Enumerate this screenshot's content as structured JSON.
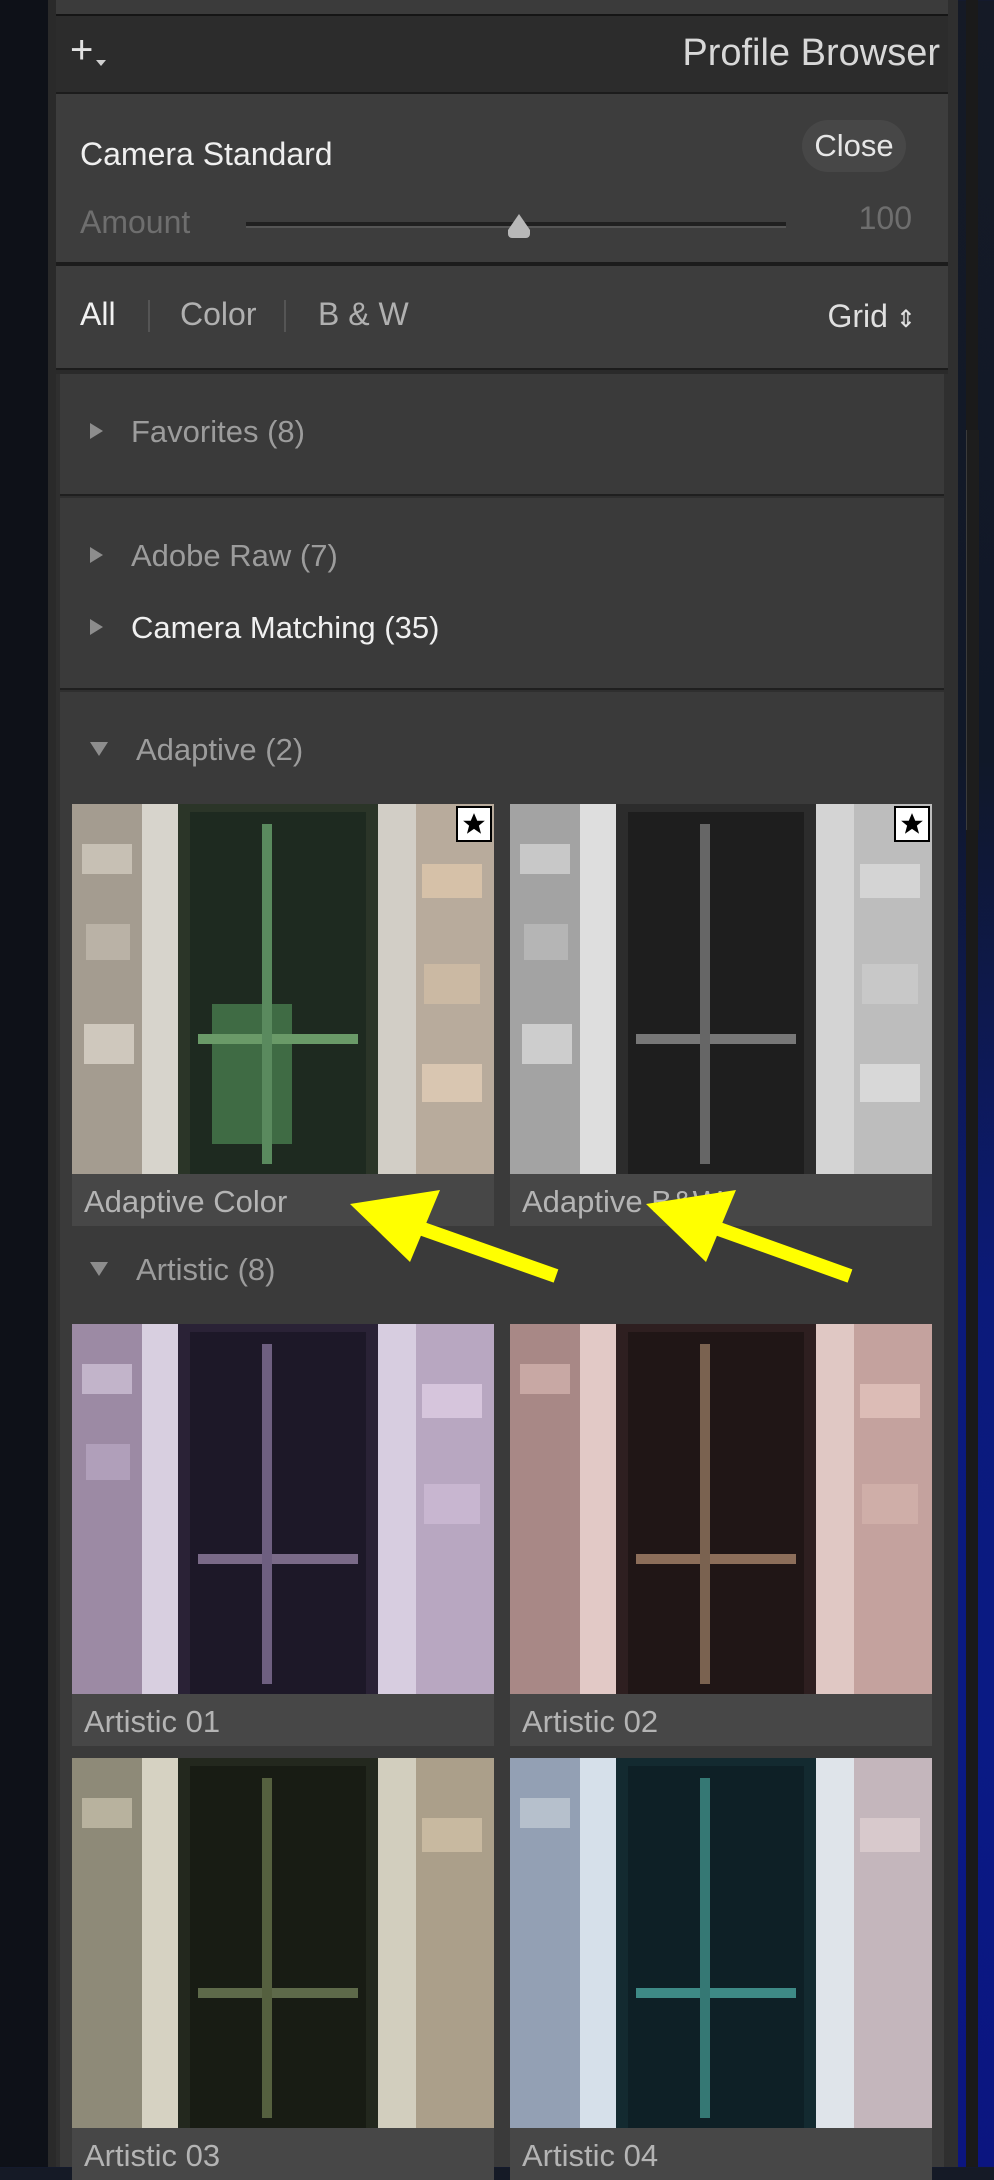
{
  "header": {
    "title": "Profile Browser",
    "add_icon": "plus-icon"
  },
  "camera": {
    "label": "Camera Standard",
    "close_label": "Close",
    "amount_label": "Amount",
    "amount_value": "100",
    "slider_fraction": 0.5
  },
  "filter": {
    "all": "All",
    "color": "Color",
    "bw": "B & W",
    "view": "Grid",
    "view_icon": "up-down-arrows-icon",
    "active": "All"
  },
  "groups": {
    "favorites": "Favorites (8)",
    "adobe_raw": "Adobe Raw (7)",
    "camera_matching": "Camera Matching (35)",
    "adaptive": "Adaptive (2)",
    "artistic": "Artistic (8)"
  },
  "thumbs": {
    "adaptive_color": "Adaptive Color",
    "adaptive_bw": "Adaptive B&W",
    "artistic_01": "Artistic 01",
    "artistic_02": "Artistic 02",
    "artistic_03": "Artistic 03",
    "artistic_04": "Artistic 04"
  },
  "colors": {
    "panel": "#3d3d3d",
    "annotation_arrow": "#ffff00",
    "background_blue": "#0b1580"
  }
}
